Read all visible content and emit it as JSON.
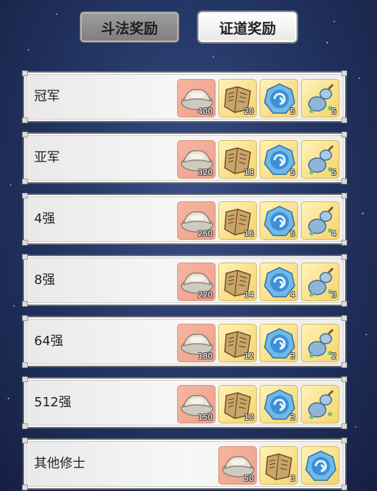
{
  "tabs": {
    "inactive_label": "斗法奖励",
    "active_label": "证道奖励"
  },
  "item_icons": [
    "silver-ingot-icon",
    "scroll-book-icon",
    "blue-orb-icon",
    "gourd-bottle-icon"
  ],
  "rows": [
    {
      "rank": "冠军",
      "counts": {
        "silver": "400",
        "book": "20",
        "orb": "5",
        "bottle": "5"
      }
    },
    {
      "rank": "亚军",
      "counts": {
        "silver": "320",
        "book": "18",
        "orb": "5",
        "bottle": "5"
      }
    },
    {
      "rank": "4强",
      "counts": {
        "silver": "260",
        "book": "16",
        "orb": "5",
        "bottle": "4"
      }
    },
    {
      "rank": "8强",
      "counts": {
        "silver": "220",
        "book": "14",
        "orb": "4",
        "bottle": "3"
      }
    },
    {
      "rank": "64强",
      "counts": {
        "silver": "180",
        "book": "12",
        "orb": "3",
        "bottle": "2"
      }
    },
    {
      "rank": "512强",
      "counts": {
        "silver": "150",
        "book": "10",
        "orb": "3",
        "bottle": ""
      }
    },
    {
      "rank": "其他修士",
      "counts": {
        "silver": "50",
        "book": "3",
        "orb": "",
        "bottle": ""
      }
    }
  ]
}
